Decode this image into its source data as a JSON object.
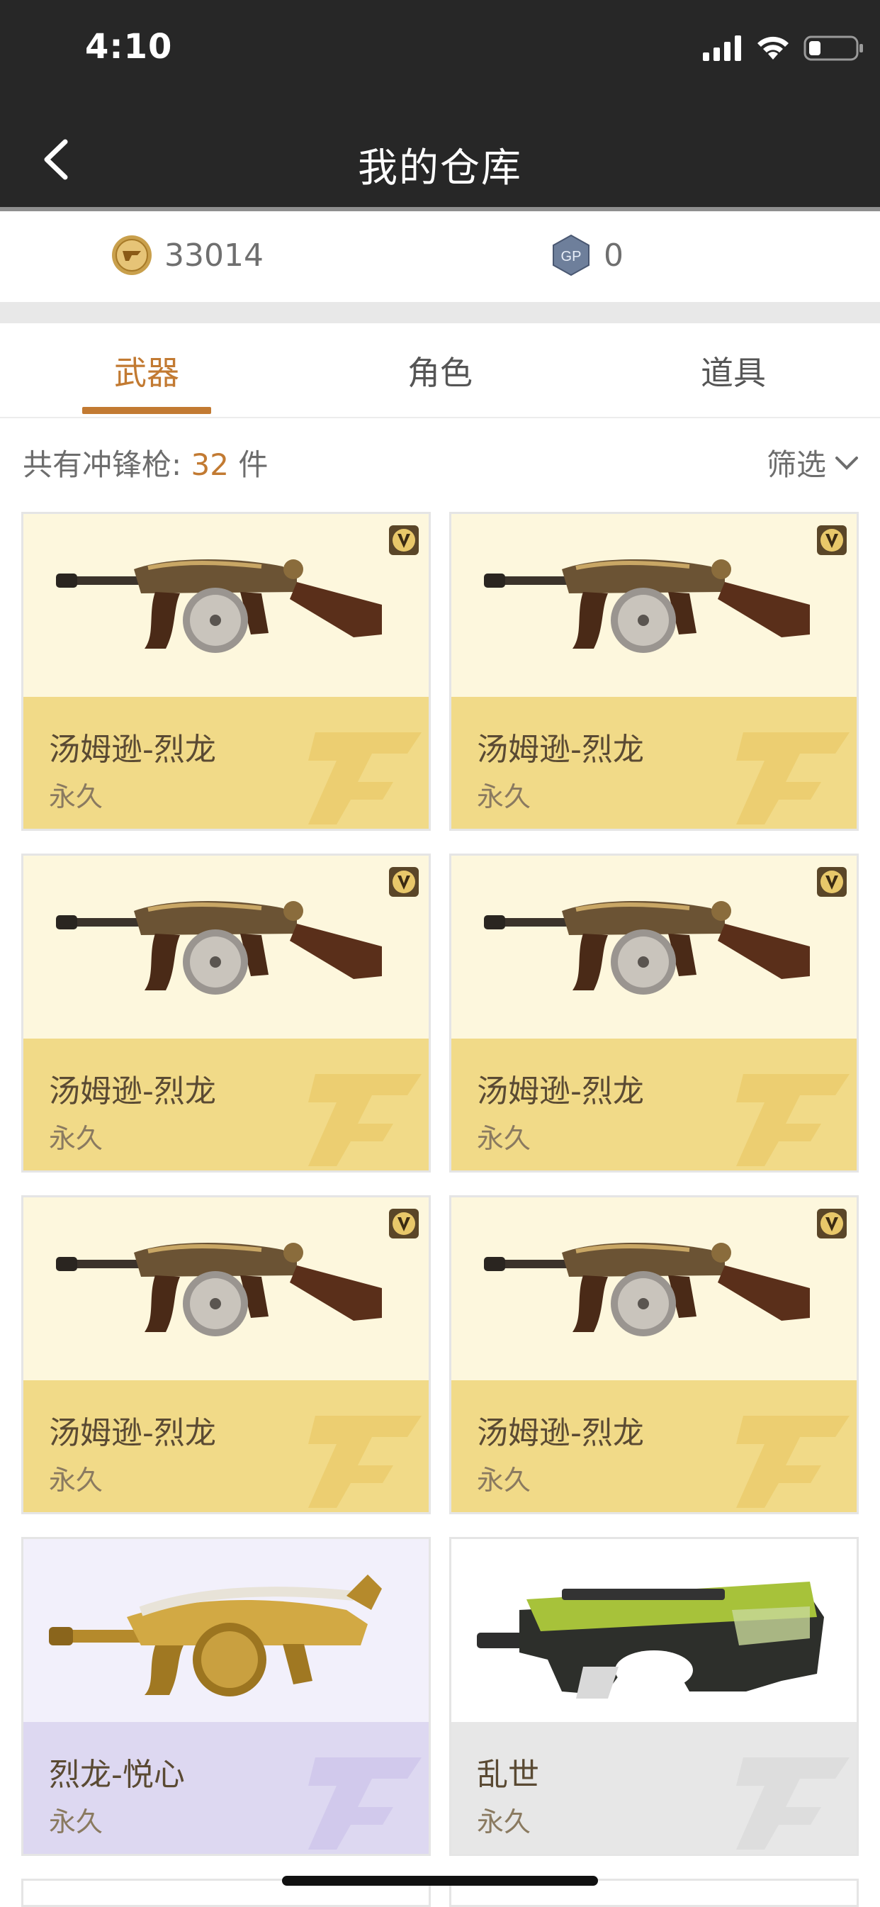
{
  "status": {
    "time": "4:10"
  },
  "nav": {
    "title": "我的仓库"
  },
  "currency": {
    "coin_value": "33014",
    "gp_value": "0",
    "gp_label": "GP"
  },
  "tabs": [
    {
      "label": "武器"
    },
    {
      "label": "角色"
    },
    {
      "label": "道具"
    }
  ],
  "filter": {
    "count_prefix": "共有冲锋枪: ",
    "count": "32",
    "count_suffix": " 件",
    "filter_label": "筛选"
  },
  "items": [
    {
      "name": "汤姆逊-烈龙",
      "duration": "永久"
    },
    {
      "name": "汤姆逊-烈龙",
      "duration": "永久"
    },
    {
      "name": "汤姆逊-烈龙",
      "duration": "永久"
    },
    {
      "name": "汤姆逊-烈龙",
      "duration": "永久"
    },
    {
      "name": "汤姆逊-烈龙",
      "duration": "永久"
    },
    {
      "name": "汤姆逊-烈龙",
      "duration": "永久"
    },
    {
      "name": "烈龙-悦心",
      "duration": "永久"
    },
    {
      "name": "乱世",
      "duration": "永久"
    }
  ],
  "colors": {
    "accent": "#c27a32",
    "gold_top": "#fdf7dd",
    "gold_bottom": "#f1da88",
    "purple_top": "#f2f0fb",
    "purple_bottom": "#ddd8f1",
    "gray_top": "#ffffff",
    "gray_bottom": "#e7e7e7"
  }
}
